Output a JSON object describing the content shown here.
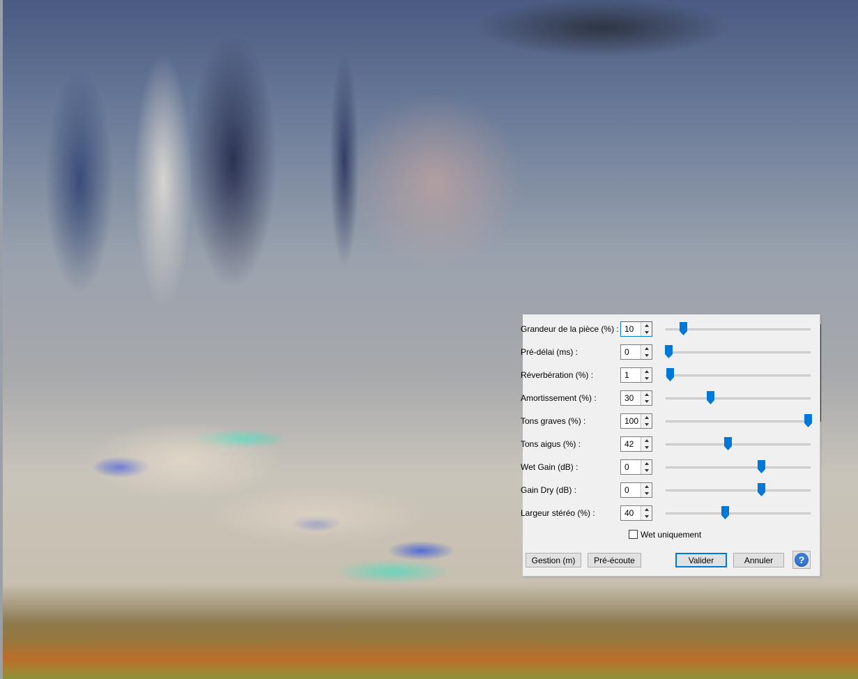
{
  "dialog": {
    "rows": [
      {
        "label": "Grandeur de la pièce (%) :",
        "value": "10",
        "fraction": 0.12
      },
      {
        "label": "Pré-délai (ms) :",
        "value": "0",
        "fraction": 0.02
      },
      {
        "label": "Réverbération (%) :",
        "value": "1",
        "fraction": 0.03
      },
      {
        "label": "Amortissement (%) :",
        "value": "30",
        "fraction": 0.31
      },
      {
        "label": "Tons graves (%) :",
        "value": "100",
        "fraction": 0.98
      },
      {
        "label": "Tons aigus (%) :",
        "value": "42",
        "fraction": 0.43
      },
      {
        "label": "Wet Gain (dB) :",
        "value": "0",
        "fraction": 0.66
      },
      {
        "label": "Gain Dry (dB) :",
        "value": "0",
        "fraction": 0.66
      },
      {
        "label": "Largeur stéréo (%) :",
        "value": "40",
        "fraction": 0.41
      }
    ],
    "wet_only_label": "Wet uniquement",
    "wet_only_checked": false,
    "buttons": {
      "manage": "Gestion (m)",
      "preview": "Pré-écoute",
      "ok": "Valider",
      "cancel": "Annuler",
      "help": "?"
    },
    "accent_color": "#0078d7"
  }
}
